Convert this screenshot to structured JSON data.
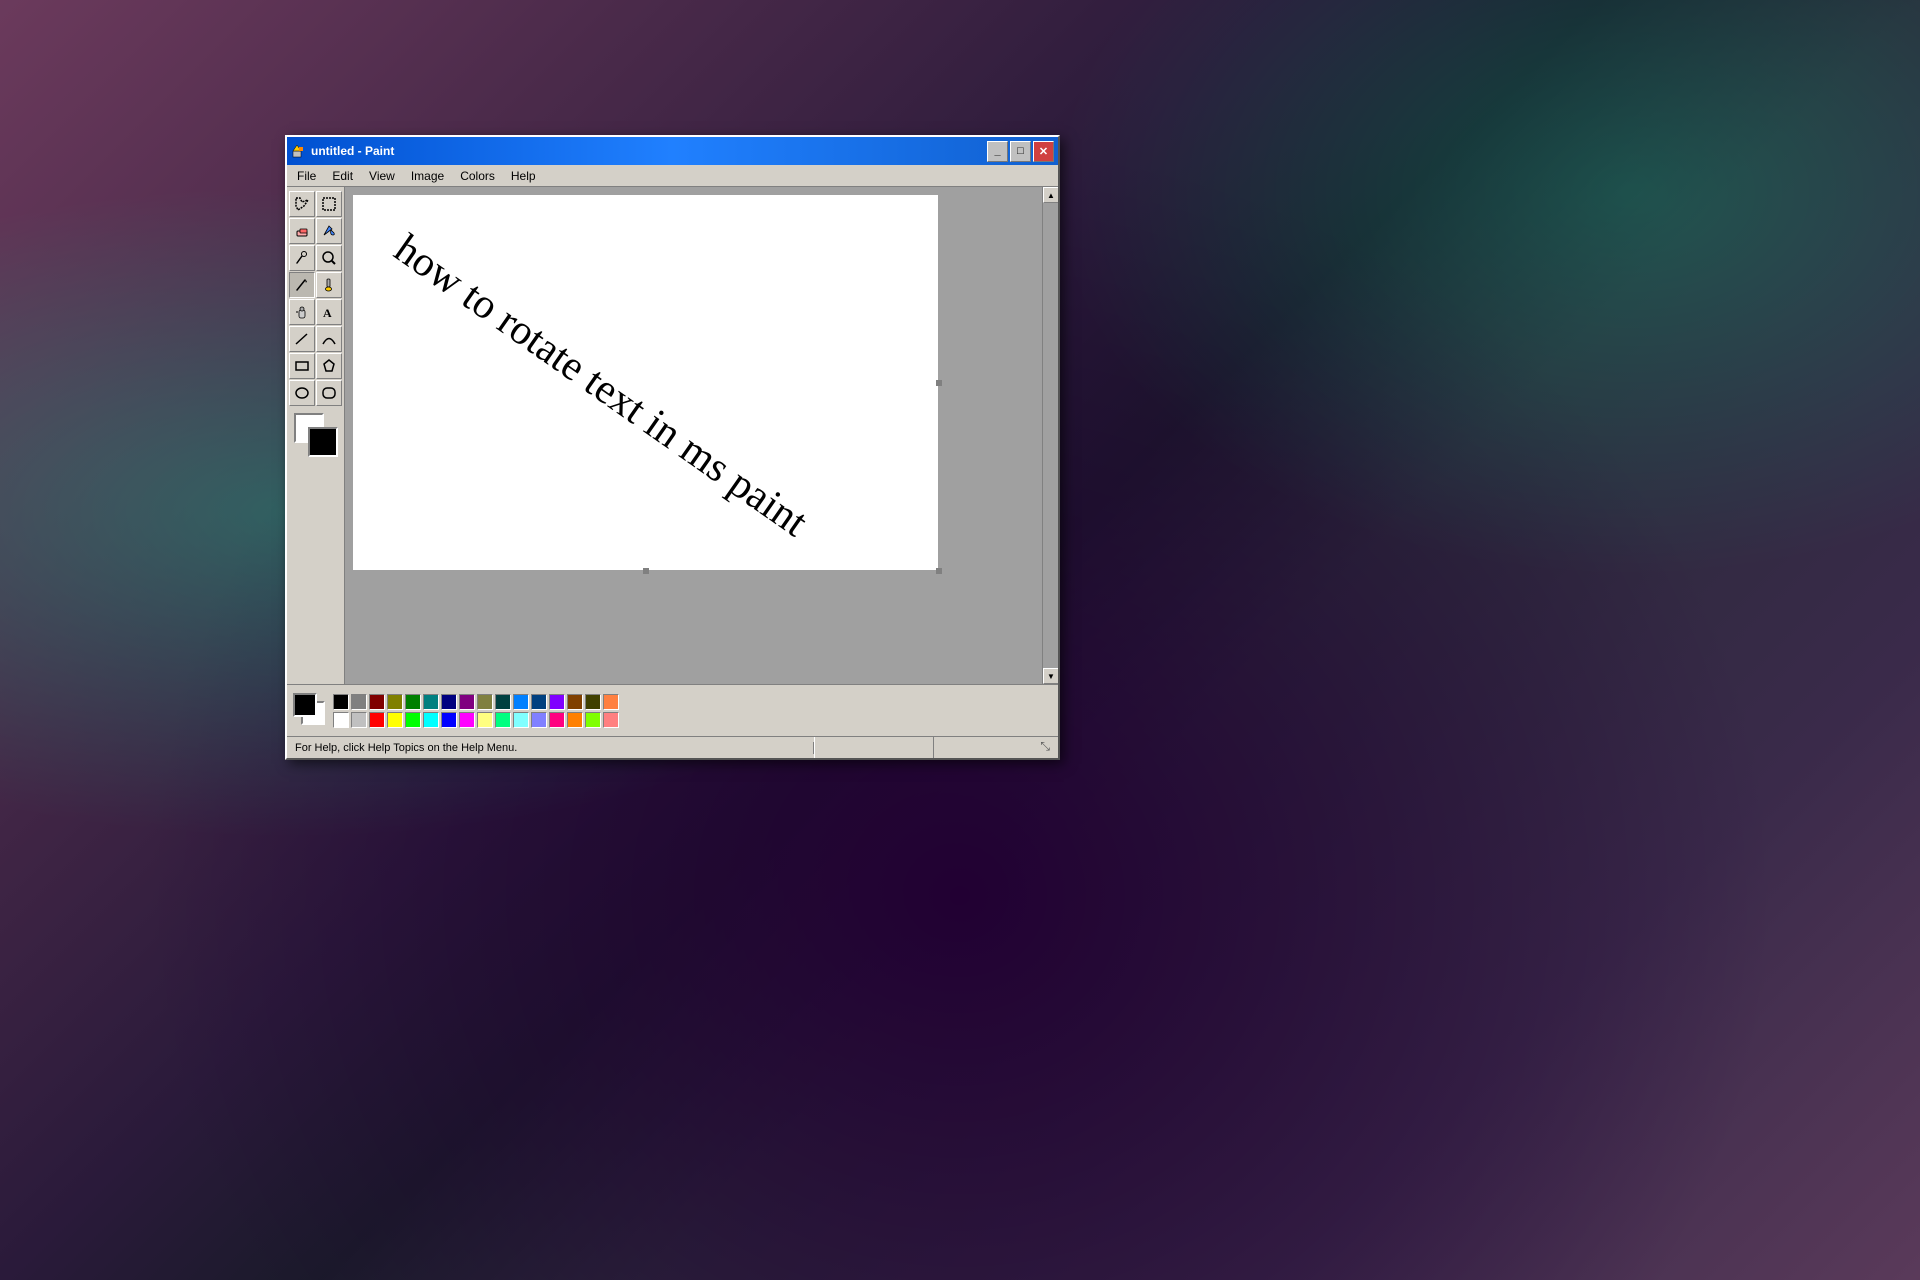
{
  "window": {
    "title": "untitled - Paint",
    "icon": "🖌"
  },
  "titlebar": {
    "minimize_label": "_",
    "maximize_label": "□",
    "close_label": "✕"
  },
  "menu": {
    "items": [
      "File",
      "Edit",
      "View",
      "Image",
      "Colors",
      "Help"
    ]
  },
  "canvas": {
    "text": "how to rotate text in ms paint"
  },
  "status": {
    "text": "For Help, click Help Topics on the Help Menu."
  },
  "palette": {
    "row1": [
      "#000000",
      "#808080",
      "#800000",
      "#808000",
      "#008000",
      "#008080",
      "#000080",
      "#800080",
      "#808040",
      "#004040",
      "#0080ff",
      "#004080",
      "#8000ff",
      "#804000",
      "#404000",
      "#ff8040"
    ],
    "row2": [
      "#ffffff",
      "#c0c0c0",
      "#ff0000",
      "#ffff00",
      "#00ff00",
      "#00ffff",
      "#0000ff",
      "#ff00ff",
      "#ffff80",
      "#00ff80",
      "#80ffff",
      "#8080ff",
      "#ff0080",
      "#ff8000",
      "#80ff00",
      "#ff8080"
    ]
  }
}
